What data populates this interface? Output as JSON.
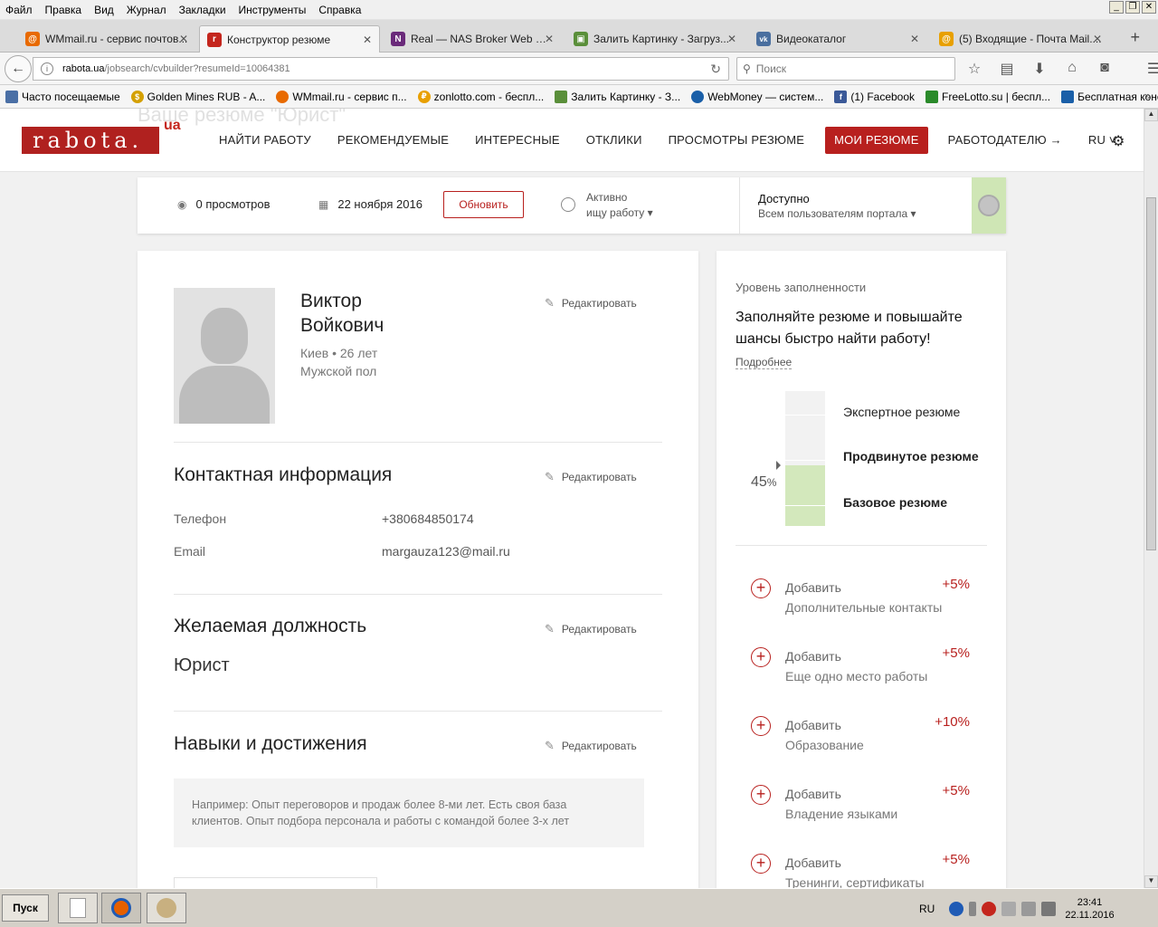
{
  "menu": [
    "Файл",
    "Правка",
    "Вид",
    "Журнал",
    "Закладки",
    "Инструменты",
    "Справка"
  ],
  "tabs": [
    {
      "label": "WMmail.ru - сервис почтов...",
      "fav_color": "#e86a00",
      "fav_icon": "@"
    },
    {
      "label": "Конструктор резюме",
      "fav_color": "#c4261d",
      "fav_icon": "r"
    },
    {
      "label": "Real — NAS Broker Web MT4",
      "fav_color": "#6a2a7a",
      "fav_icon": "N"
    },
    {
      "label": "Залить Картинку - Загруз...",
      "fav_color": "#5a8f3a",
      "fav_icon": "▣"
    },
    {
      "label": "Видеокаталог",
      "fav_color": "#4a6f9f",
      "fav_icon": "vk"
    },
    {
      "label": "(5) Входящие - Почта Mail....",
      "fav_color": "#e8a000",
      "fav_icon": "@"
    }
  ],
  "url": {
    "host": "rabota.ua",
    "path": "/jobsearch/cvbuilder?resumeId=10064381"
  },
  "search_placeholder": "Поиск",
  "bookmarks": [
    {
      "label": "Часто посещаемые",
      "color": "#4a6fa5"
    },
    {
      "label": "Golden Mines RUB - A...",
      "color": "#d4a000"
    },
    {
      "label": "WMmail.ru - сервис п...",
      "color": "#e86a00"
    },
    {
      "label": "zonlotto.com - беспл...",
      "color": "#e8a000"
    },
    {
      "label": "Залить Картинку - З...",
      "color": "#5a8f3a"
    },
    {
      "label": "WebMoney — систем...",
      "color": "#1a5fa8"
    },
    {
      "label": "(1) Facebook",
      "color": "#3b5998"
    },
    {
      "label": "FreeLotto.su | беспл...",
      "color": "#2a8a2a"
    },
    {
      "label": "Бесплатная консуль...",
      "color": "#1a5fa8"
    }
  ],
  "site": {
    "ghost_title": "Ваше резюме \"Юрист\"",
    "logo": "rabota.",
    "logo_suffix": "ua",
    "nav": [
      "НАЙТИ РАБОТУ",
      "РЕКОМЕНДУЕМЫЕ",
      "ИНТЕРЕСНЫЕ",
      "ОТКЛИКИ",
      "ПРОСМОТРЫ РЕЗЮМЕ",
      "МОИ РЕЗЮМЕ",
      "РАБОТОДАТЕЛЮ →",
      "RU ˅"
    ]
  },
  "status": {
    "views": "0 просмотров",
    "date": "22 ноября 2016",
    "refresh": "Обновить",
    "active_line1": "Активно",
    "active_line2": "ищу работу ▾",
    "access_title": "Доступно",
    "access_sub": "Всем пользователям портала ▾"
  },
  "profile": {
    "first_name": "Виктор",
    "last_name": "Войкович",
    "city_age": "Киев • 26 лет",
    "gender": "Мужской пол",
    "edit": "Редактировать"
  },
  "contacts": {
    "title": "Контактная информация",
    "phone_label": "Телефон",
    "phone": "+380684850174",
    "email_label": "Email",
    "email": "margauza123@mail.ru"
  },
  "position": {
    "title": "Желаемая должность",
    "value": "Юрист"
  },
  "skills": {
    "title": "Навыки и достижения",
    "placeholder_line1": "Например: Опыт переговоров и продаж более 8-ми лет. Есть своя база",
    "placeholder_line2": "клиентов. Опыт подбора персонала и работы с командой более 3-х лет"
  },
  "completeness": {
    "title": "Уровень заполненности",
    "headline": "Заполняйте резюме и повышайте шансы быстро найти работу!",
    "more": "Подробнее",
    "percent": "45",
    "percent_sign": "%",
    "fill_fraction": 0.45,
    "levels": [
      "Экспертное резюме",
      "Продвинутое резюме",
      "Базовое резюме"
    ],
    "add_label": "Добавить",
    "items": [
      {
        "name": "Дополнительные контакты",
        "bonus": "+5%"
      },
      {
        "name": "Еще одно место работы",
        "bonus": "+5%"
      },
      {
        "name": "Образование",
        "bonus": "+10%"
      },
      {
        "name": "Владение языками",
        "bonus": "+5%"
      },
      {
        "name": "Тренинги, сертификаты",
        "bonus": "+5%"
      }
    ]
  },
  "taskbar": {
    "start": "Пуск",
    "lang": "RU",
    "time": "23:41",
    "date": "22.11.2016"
  }
}
